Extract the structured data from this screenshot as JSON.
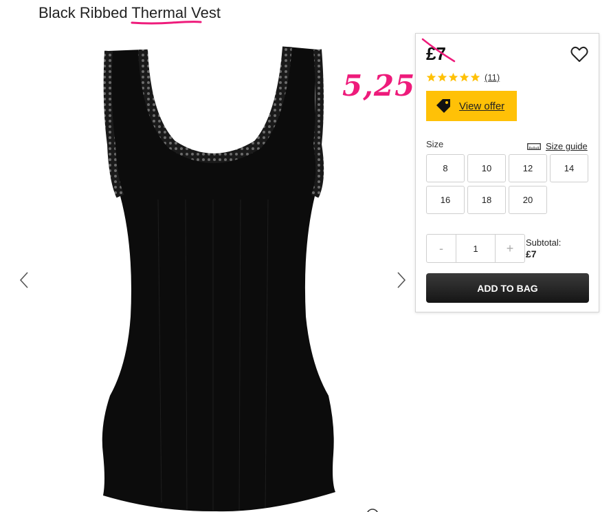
{
  "product": {
    "title": "Black Ribbed Thermal Vest"
  },
  "annotation": {
    "handwritten_price": "5,25",
    "color": "#ee1b7b"
  },
  "panel": {
    "price": "£7",
    "rating": 5,
    "review_count": "(11)",
    "offer_label": "View offer",
    "size_label": "Size",
    "size_guide_label": "Size guide",
    "sizes": [
      "8",
      "10",
      "12",
      "14",
      "16",
      "18",
      "20"
    ],
    "quantity": {
      "minus": "-",
      "value": "1",
      "plus": "+"
    },
    "subtotal_label": "Subtotal:",
    "subtotal_value": "£7",
    "add_to_bag_label": "ADD TO BAG"
  },
  "colors": {
    "offer_button": "#ffc107",
    "star": "#ffc107",
    "add_to_bag": "#1c1c1c"
  },
  "icons": {
    "wishlist": "heart-icon",
    "offer": "price-tag-icon",
    "size_guide": "ruler-icon",
    "prev": "chevron-left-icon",
    "next": "chevron-right-icon",
    "zoom": "zoom-icon"
  }
}
